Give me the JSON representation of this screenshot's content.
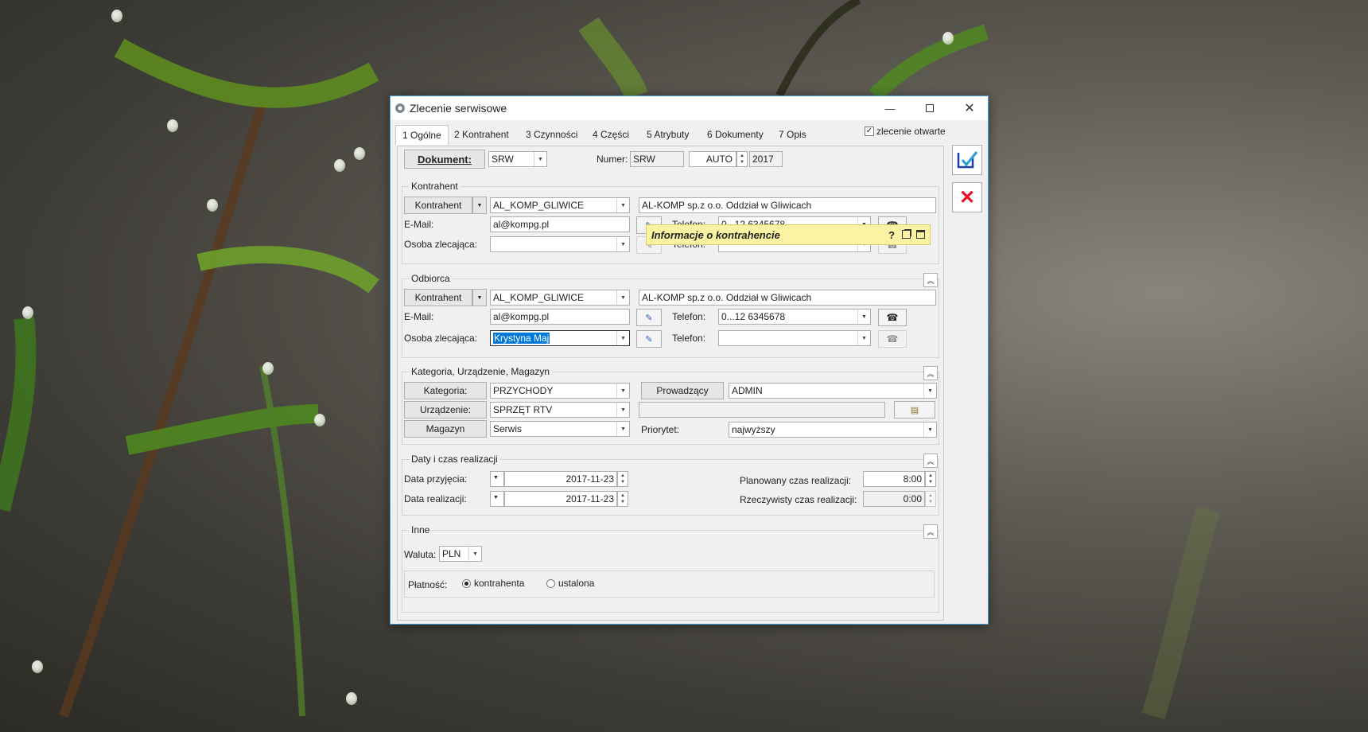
{
  "window": {
    "title": "Zlecenie serwisowe"
  },
  "tabs": [
    {
      "label": "1 Ogólne"
    },
    {
      "label": "2 Kontrahent"
    },
    {
      "label": "3 Czynności"
    },
    {
      "label": "4 Części"
    },
    {
      "label": "5 Atrybuty"
    },
    {
      "label": "6 Dokumenty"
    },
    {
      "label": "7 Opis"
    }
  ],
  "open_order": {
    "label": "zlecenie otwarte",
    "checked": true
  },
  "document": {
    "button": "Dokument:",
    "type": "SRW",
    "number_label": "Numer:",
    "number_prefix": "SRW",
    "number_auto": "AUTO",
    "year": "2017"
  },
  "tooltip": {
    "text": "Informacje o kontrahencie",
    "help": "?"
  },
  "contractor": {
    "title": "Kontrahent",
    "button": "Kontrahent",
    "code": "AL_KOMP_GLIWICE",
    "name": "AL-KOMP sp.z o.o. Oddział w Gliwicach",
    "email_label": "E-Mail:",
    "email": "al@kompg.pl",
    "phone_label": "Telefon:",
    "phone": "0...12 6345678",
    "person_label": "Osoba zlecająca:",
    "person": "",
    "phone2_label": "Telefon:",
    "phone2": ""
  },
  "recipient": {
    "title": "Odbiorca",
    "button": "Kontrahent",
    "code": "AL_KOMP_GLIWICE",
    "name": "AL-KOMP sp.z o.o. Oddział w Gliwicach",
    "email_label": "E-Mail:",
    "email": "al@kompg.pl",
    "phone_label": "Telefon:",
    "phone": "0...12 6345678",
    "person_label": "Osoba zlecająca:",
    "person": "Krystyna Maj",
    "phone2_label": "Telefon:",
    "phone2": ""
  },
  "category": {
    "title": "Kategoria, Urządzenie, Magazyn",
    "category_button": "Kategoria:",
    "category": "PRZYCHODY",
    "device_button": "Urządzenie:",
    "device": "SPRZĘT RTV",
    "warehouse_button": "Magazyn",
    "warehouse": "Serwis",
    "lead_button": "Prowadzący",
    "lead": "ADMIN",
    "priority_label": "Priorytet:",
    "priority": "najwyższy"
  },
  "dates": {
    "title": "Daty i czas realizacji",
    "accept_label": "Data przyjęcia:",
    "accept_date": "2017-11-23",
    "real_label": "Data realizacji:",
    "real_date": "2017-11-23",
    "planned_label": "Planowany czas realizacji:",
    "planned": "8:00",
    "actual_label": "Rzeczywisty czas realizacji:",
    "actual": "0:00"
  },
  "other": {
    "title": "Inne",
    "currency_label": "Waluta:",
    "currency": "PLN",
    "payment_label": "Płatność:",
    "payment_options": [
      "kontrahenta",
      "ustalona"
    ],
    "payment_selected": "kontrahenta"
  },
  "colors": {
    "accent": "#0078d7",
    "cancel": "#e81123",
    "save": "#1a3fa8",
    "tooltip": "#fbf3a4"
  }
}
